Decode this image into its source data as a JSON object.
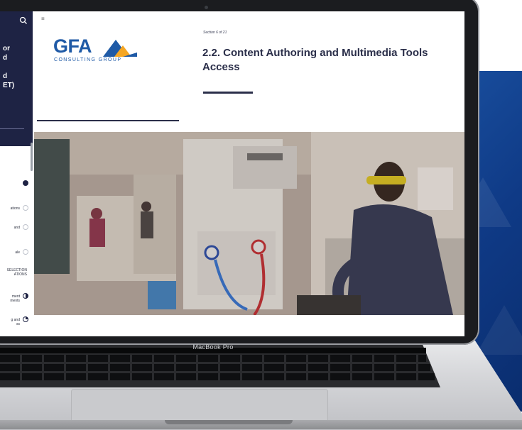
{
  "device": {
    "label": "MacBook Pro"
  },
  "sidebar": {
    "title_fragment": "or\nd\n\nd\nET)",
    "items": [
      {
        "label": "",
        "status": "done"
      },
      {
        "label": "ations",
        "status": "open"
      },
      {
        "label": "and",
        "status": "open"
      },
      {
        "label": "ale",
        "status": "open"
      },
      {
        "label": "SELECTION\nATIONS",
        "status": "none"
      },
      {
        "label": "ment\nments",
        "status": "half"
      },
      {
        "label": "g and\nss",
        "status": "part"
      }
    ]
  },
  "logo": {
    "word": "GFA",
    "tagline": "CONSULTING GROUP",
    "brand_color": "#1f5aa6",
    "accent_color": "#f5a623"
  },
  "content": {
    "section_label": "Section 6 of 21",
    "title": "2.2. Content Authoring and Multimedia Tools Access",
    "hero_image_subject": "workshop-technician-photo"
  },
  "colors": {
    "sidebar_bg": "#1e2344",
    "title_color": "#2b2f4a",
    "promo_blue": "#1d57a8"
  }
}
